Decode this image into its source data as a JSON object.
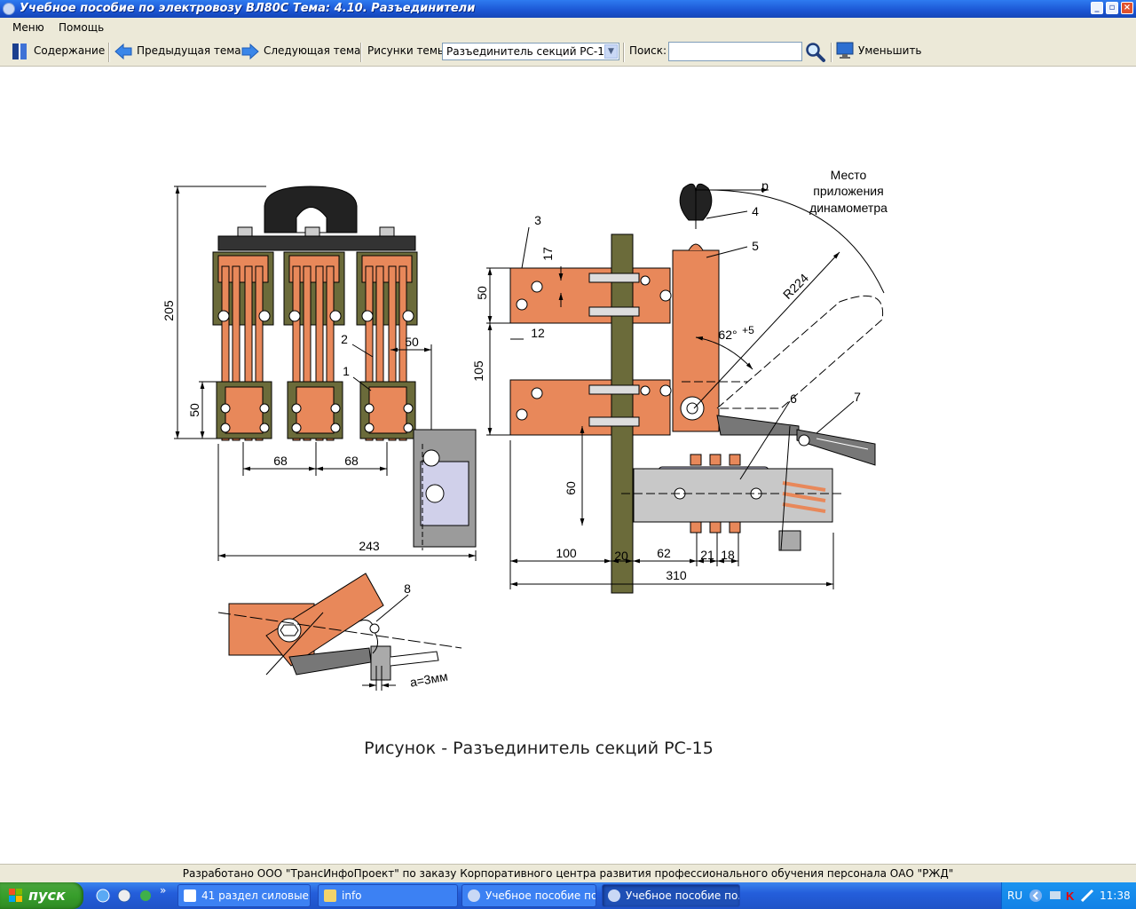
{
  "window": {
    "title": "Учебное пособие по электровозу ВЛ80С Тема: 4.10. Разъединители"
  },
  "menu": {
    "items": [
      "Меню",
      "Помощь"
    ]
  },
  "toolbar": {
    "contents": "Содержание",
    "prev": "Предыдущая тема",
    "next": "Следующая тема",
    "figures_label": "Рисунки темы",
    "figure_selected": "Разъединитель секций РС-15",
    "search_label": "Поиск:",
    "search_value": "",
    "shrink": "Уменьшить"
  },
  "figure": {
    "caption": "Рисунок - Разъединитель секций РС-15",
    "labels": {
      "n1": "1",
      "n2": "2",
      "n3": "3",
      "n4": "4",
      "n5": "5",
      "n6": "6",
      "n7": "7",
      "n8": "8",
      "place1": "Место",
      "place2": "приложения",
      "place3": "динамометра",
      "p": "р",
      "r224": "R224",
      "angle": "62°",
      "tol": "+5",
      "gap": "a=3мм"
    },
    "dims": {
      "d205": "205",
      "d50a": "50",
      "d50b": "50",
      "d68a": "68",
      "d68b": "68",
      "d243": "243",
      "d17": "17",
      "d50c": "50",
      "d12": "12",
      "d105": "105",
      "d60": "60",
      "d100": "100",
      "d20": "20",
      "d62": "62",
      "d21": "21",
      "d18": "18",
      "d310": "310"
    }
  },
  "footer": {
    "text": "Разработано ООО \"ТрансИнфоПроект\" по заказу Корпоративного центра развития профессионального обучения персонала ОАО \"РЖД\""
  },
  "taskbar": {
    "start": "пуск",
    "items": [
      "41 раздел силовые ...",
      "info",
      "Учебное пособие по...",
      "Учебное пособие по..."
    ],
    "lang": "RU",
    "time": "11:38"
  }
}
